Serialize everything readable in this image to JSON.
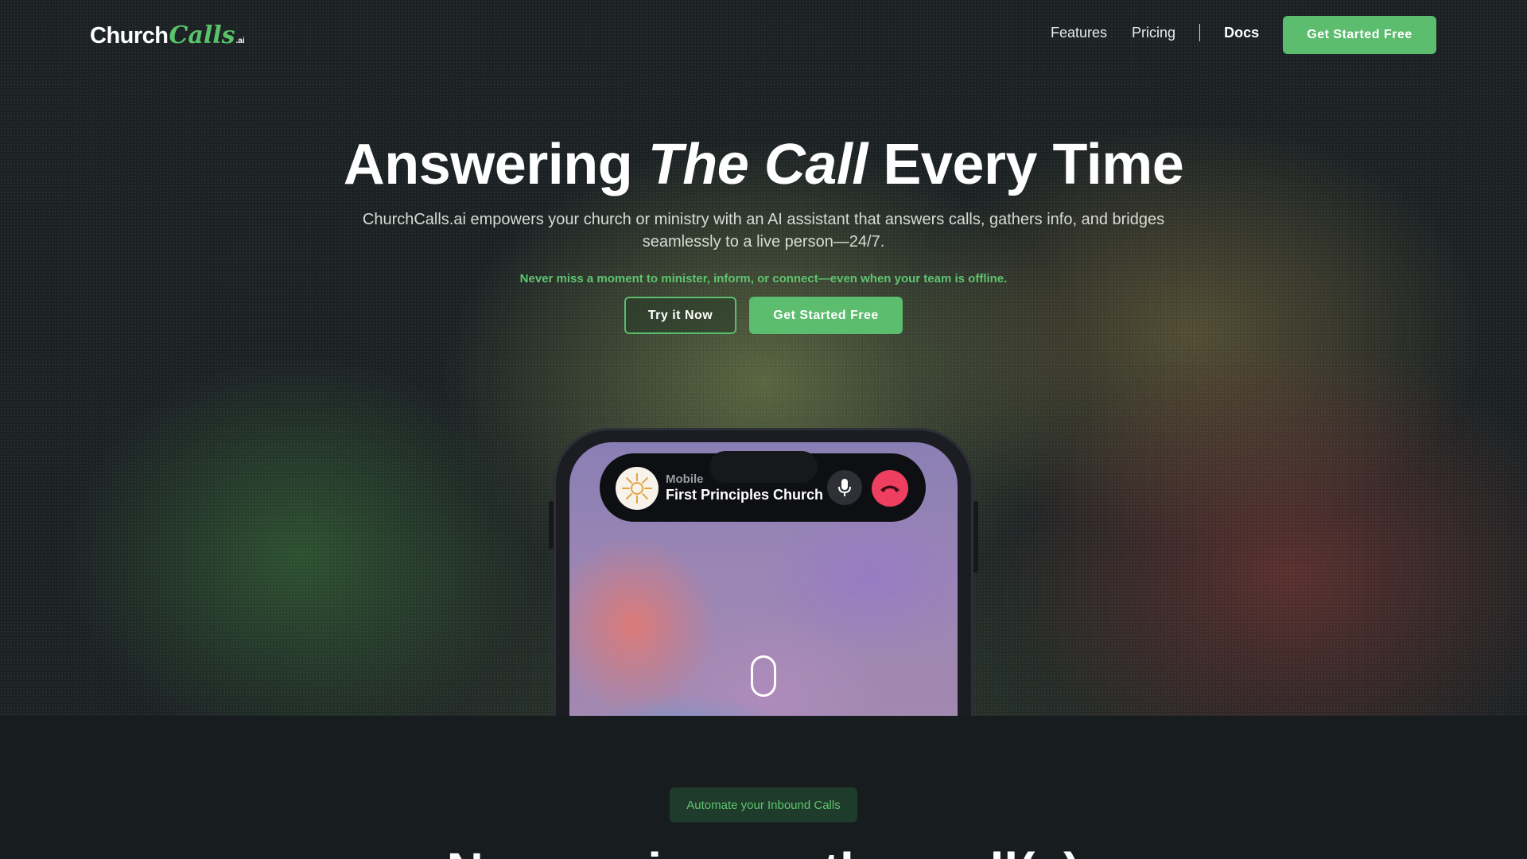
{
  "brand": {
    "church": "Church",
    "calls": "Calls",
    "ai": ".ai"
  },
  "nav": {
    "features": "Features",
    "pricing": "Pricing",
    "docs": "Docs",
    "cta": "Get Started Free"
  },
  "hero": {
    "headline_1": "Answering ",
    "headline_italic": "The Call",
    "headline_2": " Every Time",
    "subtext": "ChurchCalls.ai empowers your church or ministry with an AI assistant that answers calls, gathers info, and bridges seamlessly to a live person—24/7.",
    "tagline": "Never miss a moment to minister, inform, or connect—even when your team is offline.",
    "try_button": "Try it Now",
    "start_button": "Get Started Free"
  },
  "call": {
    "caller_type": "Mobile",
    "caller_name": "First Principles Church"
  },
  "section2": {
    "badge": "Automate your Inbound Calls",
    "title": "Never miss another call(s)"
  },
  "colors": {
    "accent": "#5cbd6e",
    "end_call": "#ee3f61",
    "background": "#171c1f"
  },
  "icons": [
    "logo",
    "microphone-icon",
    "end-call-icon",
    "church-sunburst-icon",
    "scroll-indicator-icon"
  ]
}
